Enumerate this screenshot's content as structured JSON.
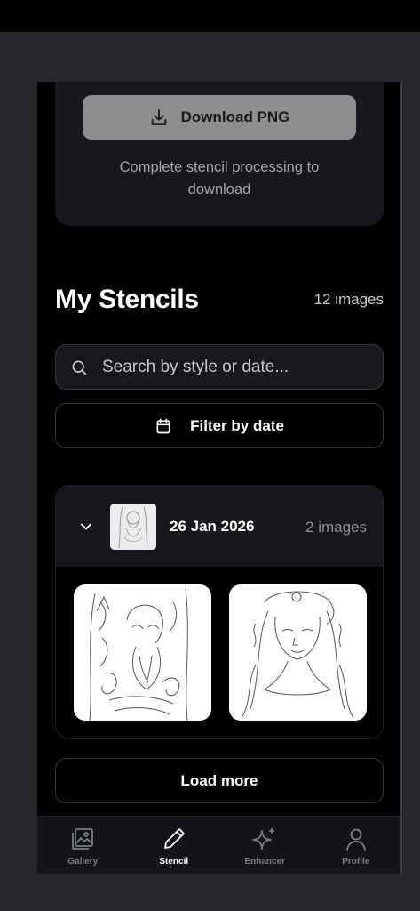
{
  "download": {
    "button_label": "Download PNG",
    "hint": "Complete stencil processing to download"
  },
  "stencils": {
    "title": "My Stencils",
    "count": "12 images",
    "search_placeholder": "Search by style or date...",
    "filter_label": "Filter by date",
    "groups": [
      {
        "date": "26 Jan 2026",
        "count": "2 images",
        "images": [
          {
            "subject": "bearded-god-stencil"
          },
          {
            "subject": "goddess-portrait-stencil"
          }
        ]
      }
    ],
    "load_more_label": "Load more"
  },
  "nav": {
    "tabs": [
      {
        "label": "Gallery",
        "icon": "gallery-icon",
        "active": false
      },
      {
        "label": "Stencil",
        "icon": "pencil-icon",
        "active": true
      },
      {
        "label": "Enhancer",
        "icon": "sparkle-icon",
        "active": false
      },
      {
        "label": "Profile",
        "icon": "user-icon",
        "active": false
      }
    ]
  },
  "colors": {
    "background": "#000000",
    "card": "#17181b",
    "button_disabled": "#8e8e91",
    "active_tab": "#ffffff",
    "inactive_tab": "#7c7e86"
  }
}
